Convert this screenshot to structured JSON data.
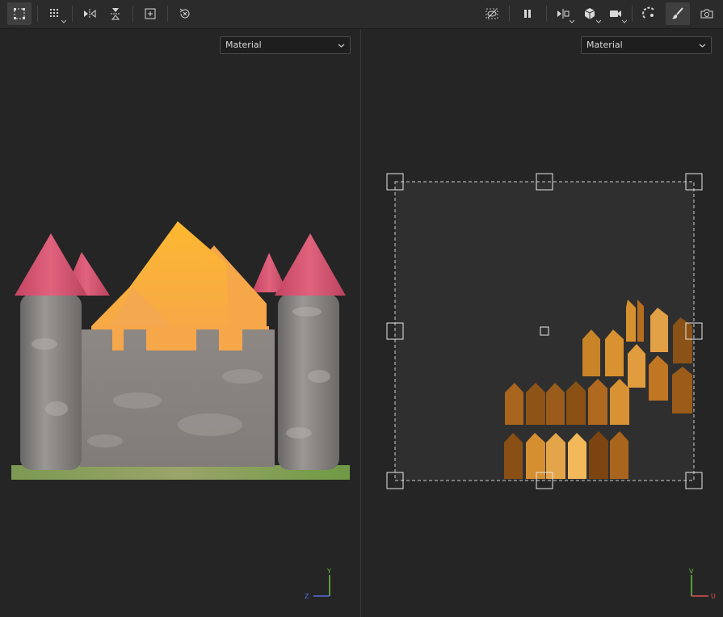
{
  "toolbar": {
    "left_tools": [
      "select-tool",
      "grid-options",
      "mirror-horizontal",
      "mirror-vertical",
      "frame-selection",
      "reset-view"
    ],
    "right_tools": [
      "hide-overlay",
      "pause",
      "split-view",
      "display-mode",
      "camera",
      "lighting",
      "paint-brush",
      "screenshot"
    ],
    "active_tools": [
      "select-tool",
      "paint-brush"
    ]
  },
  "left_viewport": {
    "display_mode": "Material",
    "axes": {
      "vertical": "Y",
      "horizontal": "Z"
    },
    "axis_colors": {
      "vertical": "#6cc24a",
      "horizontal": "#5a6de0"
    }
  },
  "right_viewport": {
    "display_mode": "Material",
    "axes": {
      "vertical": "V",
      "horizontal": "U"
    },
    "axis_colors": {
      "vertical": "#6cc24a",
      "horizontal": "#e05555"
    }
  },
  "colors": {
    "toolbar_bg": "#2b2b2b",
    "viewport_bg": "#252525",
    "stone": "#8a8784",
    "roof": "#d0506e",
    "gold": "#f6a740",
    "wood": "#b06a20"
  }
}
